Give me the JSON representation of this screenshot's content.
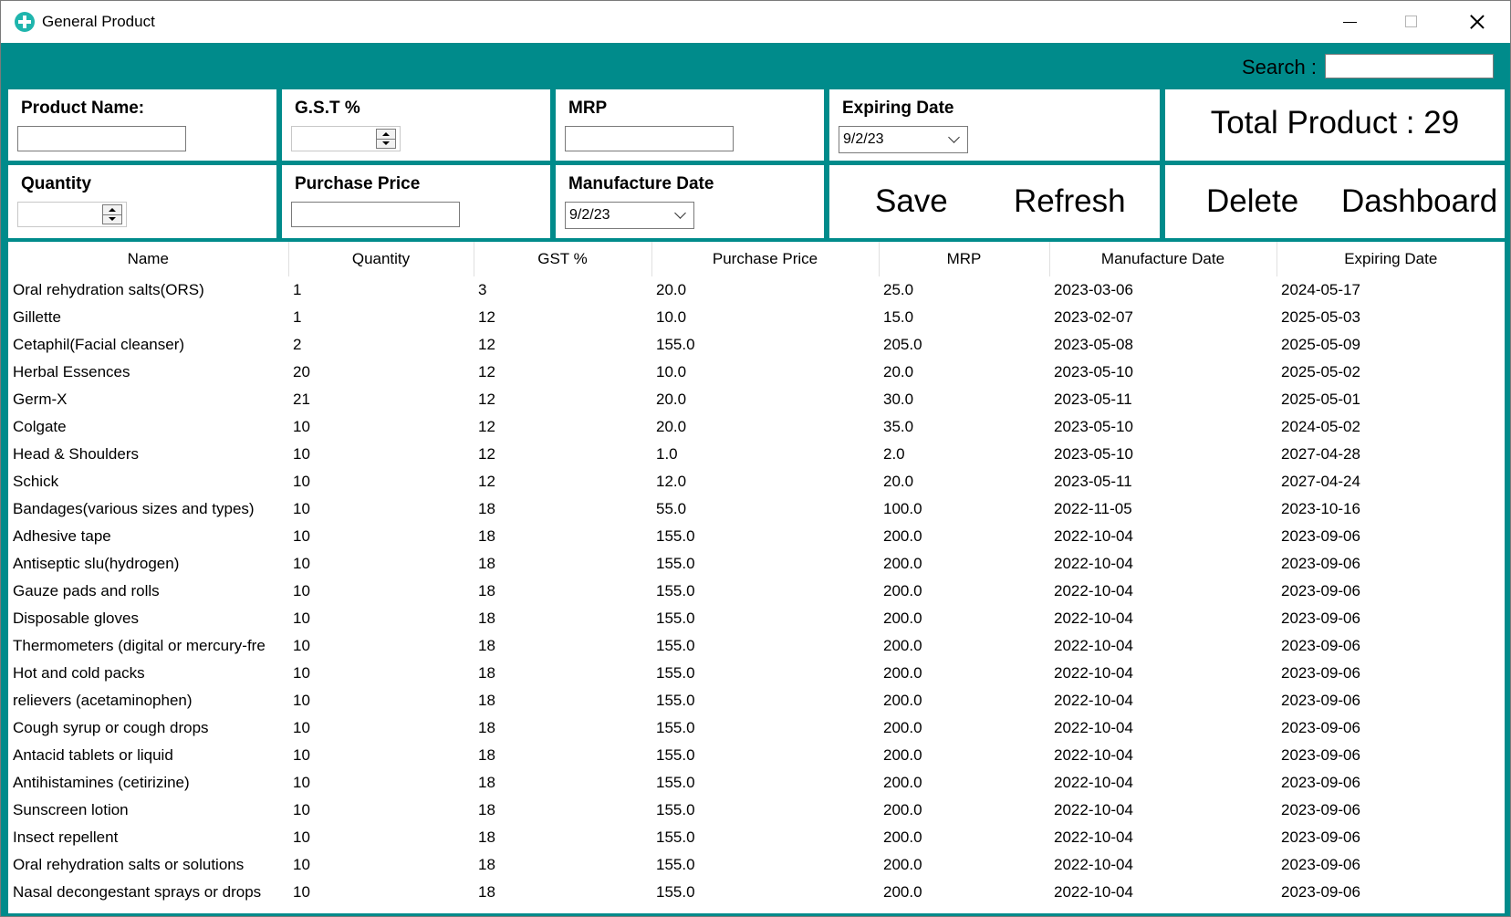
{
  "window": {
    "title": "General Product"
  },
  "search": {
    "label": "Search :",
    "value": ""
  },
  "form": {
    "product_name_label": "Product Name:",
    "gst_label": "G.S.T %",
    "mrp_label": "MRP",
    "expiring_date_label": "Expiring Date",
    "expiring_date_value": "9/2/23",
    "quantity_label": "Quantity",
    "purchase_price_label": "Purchase Price",
    "manufacture_date_label": "Manufacture Date",
    "manufacture_date_value": "9/2/23",
    "total_product": "Total Product : 29"
  },
  "buttons": {
    "save": "Save",
    "refresh": "Refresh",
    "delete": "Delete",
    "dashboard": "Dashboard"
  },
  "colors": {
    "teal": "#008b8b",
    "app_icon": "#1fb5ad"
  },
  "table": {
    "columns": [
      "Name",
      "Quantity",
      "GST %",
      "Purchase Price",
      "MRP",
      "Manufacture Date",
      "Expiring Date"
    ],
    "rows": [
      [
        "Oral rehydration salts(ORS)",
        "1",
        "3",
        "20.0",
        "25.0",
        "2023-03-06",
        "2024-05-17"
      ],
      [
        "Gillette",
        "1",
        "12",
        "10.0",
        "15.0",
        "2023-02-07",
        "2025-05-03"
      ],
      [
        "Cetaphil(Facial cleanser)",
        "2",
        "12",
        "155.0",
        "205.0",
        "2023-05-08",
        "2025-05-09"
      ],
      [
        "Herbal Essences",
        "20",
        "12",
        "10.0",
        "20.0",
        "2023-05-10",
        "2025-05-02"
      ],
      [
        "Germ-X",
        "21",
        "12",
        "20.0",
        "30.0",
        "2023-05-11",
        "2025-05-01"
      ],
      [
        "Colgate",
        "10",
        "12",
        "20.0",
        "35.0",
        "2023-05-10",
        "2024-05-02"
      ],
      [
        "Head & Shoulders",
        "10",
        "12",
        "1.0",
        "2.0",
        "2023-05-10",
        "2027-04-28"
      ],
      [
        "Schick",
        "10",
        "12",
        "12.0",
        "20.0",
        "2023-05-11",
        "2027-04-24"
      ],
      [
        "Bandages(various sizes and types)",
        "10",
        "18",
        "55.0",
        "100.0",
        "2022-11-05",
        "2023-10-16"
      ],
      [
        "Adhesive tape",
        "10",
        "18",
        "155.0",
        "200.0",
        "2022-10-04",
        "2023-09-06"
      ],
      [
        "Antiseptic slu(hydrogen)",
        "10",
        "18",
        "155.0",
        "200.0",
        "2022-10-04",
        "2023-09-06"
      ],
      [
        "Gauze pads and rolls",
        "10",
        "18",
        "155.0",
        "200.0",
        "2022-10-04",
        "2023-09-06"
      ],
      [
        "Disposable gloves",
        "10",
        "18",
        "155.0",
        "200.0",
        "2022-10-04",
        "2023-09-06"
      ],
      [
        "Thermometers (digital or mercury-fre",
        "10",
        "18",
        "155.0",
        "200.0",
        "2022-10-04",
        "2023-09-06"
      ],
      [
        "Hot and cold packs",
        "10",
        "18",
        "155.0",
        "200.0",
        "2022-10-04",
        "2023-09-06"
      ],
      [
        "relievers (acetaminophen)",
        "10",
        "18",
        "155.0",
        "200.0",
        "2022-10-04",
        "2023-09-06"
      ],
      [
        "Cough syrup or cough drops",
        "10",
        "18",
        "155.0",
        "200.0",
        "2022-10-04",
        "2023-09-06"
      ],
      [
        "Antacid tablets or liquid",
        "10",
        "18",
        "155.0",
        "200.0",
        "2022-10-04",
        "2023-09-06"
      ],
      [
        "Antihistamines (cetirizine)",
        "10",
        "18",
        "155.0",
        "200.0",
        "2022-10-04",
        "2023-09-06"
      ],
      [
        "Sunscreen lotion",
        "10",
        "18",
        "155.0",
        "200.0",
        "2022-10-04",
        "2023-09-06"
      ],
      [
        "Insect repellent",
        "10",
        "18",
        "155.0",
        "200.0",
        "2022-10-04",
        "2023-09-06"
      ],
      [
        "Oral rehydration salts or solutions",
        "10",
        "18",
        "155.0",
        "200.0",
        "2022-10-04",
        "2023-09-06"
      ],
      [
        "Nasal decongestant sprays or drops",
        "10",
        "18",
        "155.0",
        "200.0",
        "2022-10-04",
        "2023-09-06"
      ]
    ]
  }
}
